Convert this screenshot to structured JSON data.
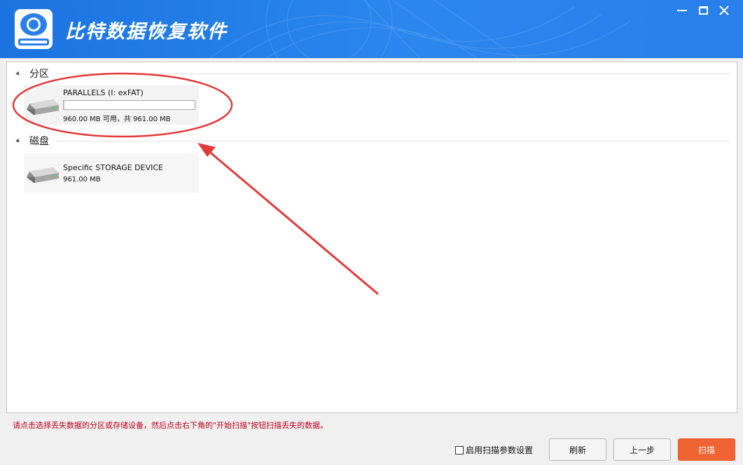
{
  "app": {
    "title": "比特数据恢复软件"
  },
  "window_controls": {
    "minimize": "minimize",
    "maximize": "maximize",
    "close": "close"
  },
  "sections": {
    "partition": {
      "label": "分区",
      "items": [
        {
          "name": "PARALLELS (I: exFAT)",
          "size_text": "960.00 MB 可用，共 961.00 MB",
          "used_fraction": 0.001
        }
      ]
    },
    "disk": {
      "label": "磁盘",
      "items": [
        {
          "name": "Specific STORAGE DEVICE",
          "size_text": "961.00 MB"
        }
      ]
    }
  },
  "footer": {
    "hint": "请点击选择丢失数据的分区或存储设备，然后点击右下角的\"开始扫描\"按钮扫描丢失的数据。",
    "enable_scan_params": "启用扫描参数设置",
    "refresh": "刷新",
    "back": "上一步",
    "scan": "扫描"
  },
  "colors": {
    "titlebar": "#2a7fea",
    "primary_button": "#f06332",
    "hint_text": "#c0001a",
    "annotation": "#e33a3a"
  },
  "icons": {
    "app": "data-recovery-disk-icon",
    "drive": "hard-drive-icon"
  }
}
